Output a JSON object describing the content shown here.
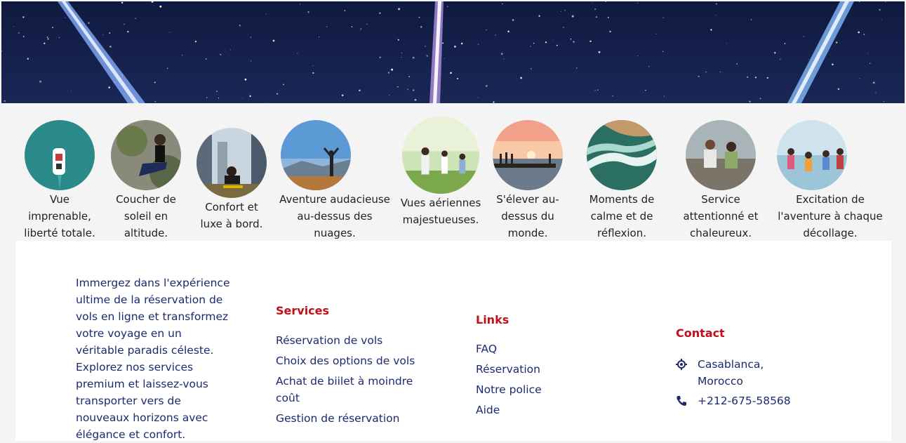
{
  "gallery": {
    "items": [
      {
        "caption": "Vue imprenable, liberté totale.",
        "icon": "boat-aerial-photo"
      },
      {
        "caption": "Coucher de soleil en altitude.",
        "icon": "woman-sitting-photo"
      },
      {
        "caption": "Confort et luxe à bord.",
        "icon": "city-skateboarder-photo"
      },
      {
        "caption": "Aventure audacieuse au-dessus des nuages.",
        "icon": "mountain-top-photo"
      },
      {
        "caption": "Vues aériennes majestueuses.",
        "icon": "family-park-photo"
      },
      {
        "caption": "S'élever au-dessus du monde.",
        "icon": "pier-sunset-photo"
      },
      {
        "caption": "Moments de calme et de réflexion.",
        "icon": "ocean-wave-photo"
      },
      {
        "caption": "Service attentionné et chaleureux.",
        "icon": "friends-rocks-photo"
      },
      {
        "caption": "Excitation de l'aventure à chaque décollage.",
        "icon": "kids-beach-photo"
      }
    ]
  },
  "footer": {
    "about": "Immergez dans l'expérience ultime de la réservation de vols en ligne et transformez votre voyage en un véritable paradis céleste. Explorez nos services premium et laissez-vous transporter vers de nouveaux horizons avec élégance et confort.",
    "services": {
      "title": "Services",
      "items": [
        "Réservation de vols",
        "Choix des options de vols",
        "Achat de biilet à moindre coût",
        "Gestion de réservation"
      ]
    },
    "links": {
      "title": "Links",
      "items": [
        "FAQ",
        "Réservation",
        "Notre police",
        "Aide"
      ]
    },
    "contact": {
      "title": "Contact",
      "address": "Casablanca, Morocco",
      "phone": "+212-675-58568",
      "icons": [
        "location-icon",
        "phone-icon"
      ]
    }
  },
  "colors": {
    "accent_red": "#c0101a",
    "text_navy": "#1d2a6e",
    "hero_sky": "#14204a"
  }
}
